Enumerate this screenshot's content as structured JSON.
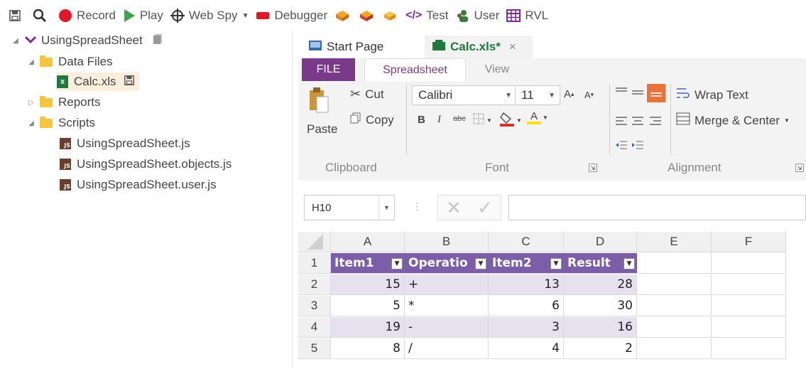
{
  "toolbar": {
    "record": "Record",
    "play": "Play",
    "web_spy": "Web Spy",
    "debugger": "Debugger",
    "test": "Test",
    "user": "User",
    "rvl": "RVL"
  },
  "tree": {
    "root": "UsingSpreadSheet",
    "data_files": "Data Files",
    "calc_file": "Calc.xls",
    "reports": "Reports",
    "scripts": "Scripts",
    "script1": "UsingSpreadSheet.js",
    "script2": "UsingSpreadSheet.objects.js",
    "script3": "UsingSpreadSheet.user.js"
  },
  "tabs": {
    "start_page": "Start Page",
    "calc": "Calc.xls*",
    "close": "×"
  },
  "ribbon_tabs": {
    "file": "FILE",
    "spreadsheet": "Spreadsheet",
    "view": "View"
  },
  "ribbon": {
    "paste": "Paste",
    "cut": "Cut",
    "copy": "Copy",
    "font_name": "Calibri",
    "font_size": "11",
    "bold": "B",
    "italic": "I",
    "wrap_text": "Wrap Text",
    "merge_center": "Merge & Center",
    "group_clipboard": "Clipboard",
    "group_font": "Font",
    "group_alignment": "Alignment",
    "font_color": "#d9312b",
    "highlight_color": "#ffe200",
    "align_active_color": "#e8733a"
  },
  "formula_bar": {
    "cell_ref": "H10",
    "formula": ""
  },
  "sheet": {
    "columns": [
      "A",
      "B",
      "C",
      "D",
      "E",
      "F"
    ],
    "rows": [
      "1",
      "2",
      "3",
      "4",
      "5"
    ],
    "header": [
      "Item1",
      "Operatio",
      "Item2",
      "Result"
    ],
    "data": [
      [
        "15",
        "+",
        "13",
        "28"
      ],
      [
        "5",
        "*",
        "6",
        "30"
      ],
      [
        "19",
        "-",
        "3",
        "16"
      ],
      [
        "8",
        "/",
        "4",
        "2"
      ]
    ],
    "header_color": "#7b5ea7",
    "band_color": "#e6e1ef"
  }
}
